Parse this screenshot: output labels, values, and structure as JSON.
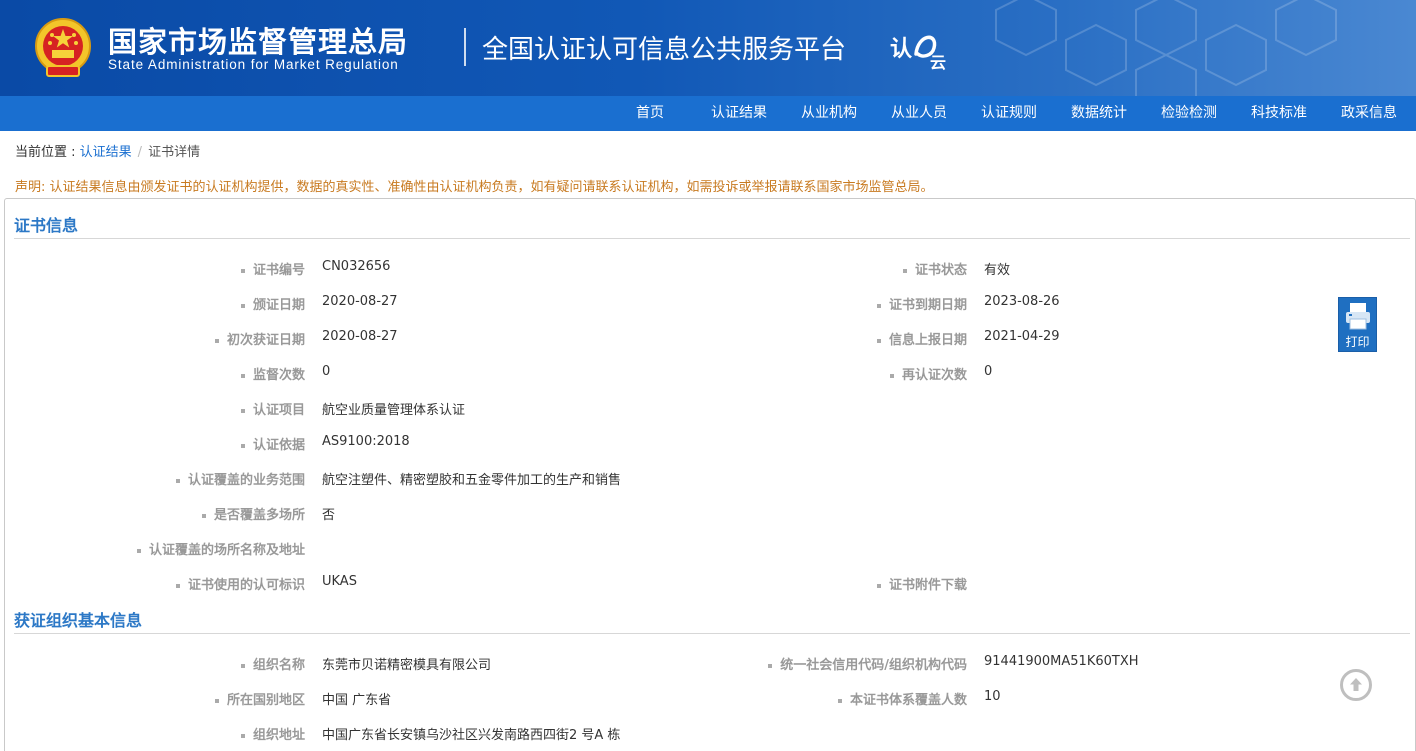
{
  "header": {
    "agency_cn": "国家市场监督管理总局",
    "agency_en": "State Administration  for  Market Regulation",
    "platform": "全国认证认可信息公共服务平台",
    "logo_text_1": "认",
    "logo_text_2": "云",
    "emblem_icon": "national-emblem-icon",
    "colors": {
      "banner": "#0a4aa6",
      "nav": "#1a6fd0"
    }
  },
  "nav": {
    "items": [
      {
        "label": "首页"
      },
      {
        "label": "认证结果"
      },
      {
        "label": "从业机构"
      },
      {
        "label": "从业人员"
      },
      {
        "label": "认证规则"
      },
      {
        "label": "数据统计"
      },
      {
        "label": "检验检测"
      },
      {
        "label": "科技标准"
      },
      {
        "label": "政采信息"
      }
    ]
  },
  "breadcrumb": {
    "prefix": "当前位置 : ",
    "link": "认证结果",
    "separator": "/",
    "current": "证书详情"
  },
  "notice": "声明: 认证结果信息由颁发证书的认证机构提供，数据的真实性、准确性由认证机构负责，如有疑问请联系认证机构，如需投诉或举报请联系国家市场监管总局。",
  "cert_section": {
    "title": "证书信息",
    "rows": [
      {
        "label": "证书编号",
        "value": "CN032656",
        "label_r": "证书状态",
        "value_r": "有效"
      },
      {
        "label": "颁证日期",
        "value": "2020-08-27",
        "label_r": "证书到期日期",
        "value_r": "2023-08-26"
      },
      {
        "label": "初次获证日期",
        "value": "2020-08-27",
        "label_r": "信息上报日期",
        "value_r": "2021-04-29"
      },
      {
        "label": "监督次数",
        "value": "0",
        "label_r": "再认证次数",
        "value_r": "0"
      },
      {
        "label": "认证项目",
        "value": "航空业质量管理体系认证"
      },
      {
        "label": "认证依据",
        "value": "AS9100:2018"
      },
      {
        "label": "认证覆盖的业务范围",
        "value": "航空注塑件、精密塑胶和五金零件加工的生产和销售"
      },
      {
        "label": "是否覆盖多场所",
        "value": "否"
      },
      {
        "label": "认证覆盖的场所名称及地址",
        "value": ""
      },
      {
        "label": "证书使用的认可标识",
        "value": "UKAS",
        "label_r": "证书附件下载",
        "value_r": ""
      }
    ]
  },
  "org_section": {
    "title": "获证组织基本信息",
    "rows": [
      {
        "label": "组织名称",
        "value": "东莞市贝诺精密模具有限公司",
        "label_r": "统一社会信用代码/组织机构代码",
        "value_r": "91441900MA51K60TXH"
      },
      {
        "label": "所在国别地区",
        "value": "中国 广东省",
        "label_r": "本证书体系覆盖人数",
        "value_r": "10"
      },
      {
        "label": "组织地址",
        "value": "中国广东省长安镇乌沙社区兴发南路西四街2 号A 栋"
      }
    ]
  },
  "print_button": {
    "label": "打印",
    "icon": "printer-icon"
  },
  "scroll_top": {
    "icon": "arrow-up-circle-icon"
  }
}
